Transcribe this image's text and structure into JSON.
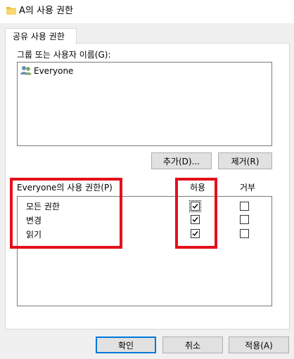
{
  "window": {
    "title": "A의 사용 권한"
  },
  "tabs": [
    {
      "label": "공유 사용 권한"
    }
  ],
  "users": {
    "label": "그룹 또는 사용자 이름(G):",
    "items": [
      {
        "name": "Everyone",
        "icon": "users-group-icon"
      }
    ]
  },
  "buttons": {
    "add": "추가(D)...",
    "remove": "제거(R)",
    "ok": "확인",
    "cancel": "취소",
    "apply": "적용(A)"
  },
  "permissions": {
    "label": "Everyone의 사용 권한(P)",
    "allow_header": "허용",
    "deny_header": "거부",
    "rows": [
      {
        "name": "모든 권한",
        "allow": true,
        "deny": false
      },
      {
        "name": "변경",
        "allow": true,
        "deny": false
      },
      {
        "name": "읽기",
        "allow": true,
        "deny": false
      }
    ]
  },
  "colors": {
    "highlight": "#e3101a",
    "accent": "#0078d7"
  }
}
